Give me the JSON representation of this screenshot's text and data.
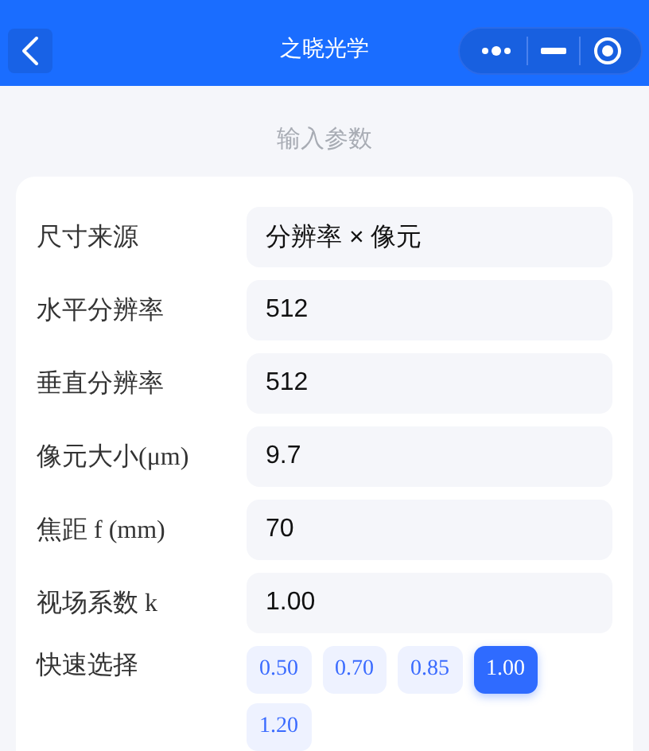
{
  "nav_bar": {
    "title": "之晓光学"
  },
  "section_title": "输入参数",
  "fields": [
    {
      "label": "尺寸来源",
      "value": "分辨率 × 像元"
    },
    {
      "label": "水平分辨率",
      "value": "512"
    },
    {
      "label": "垂直分辨率",
      "value": "512"
    },
    {
      "label": "像元大小(μm)",
      "value": "9.7"
    },
    {
      "label": "焦距 f (mm)",
      "value": "70"
    },
    {
      "label": "视场系数 k",
      "value": "1.00"
    }
  ],
  "quick_select": {
    "label": "快速选择",
    "options": [
      {
        "label": "0.50",
        "selected": false
      },
      {
        "label": "0.70",
        "selected": false
      },
      {
        "label": "0.85",
        "selected": false
      },
      {
        "label": "1.00",
        "selected": true
      },
      {
        "label": "1.20",
        "selected": false
      }
    ]
  }
}
